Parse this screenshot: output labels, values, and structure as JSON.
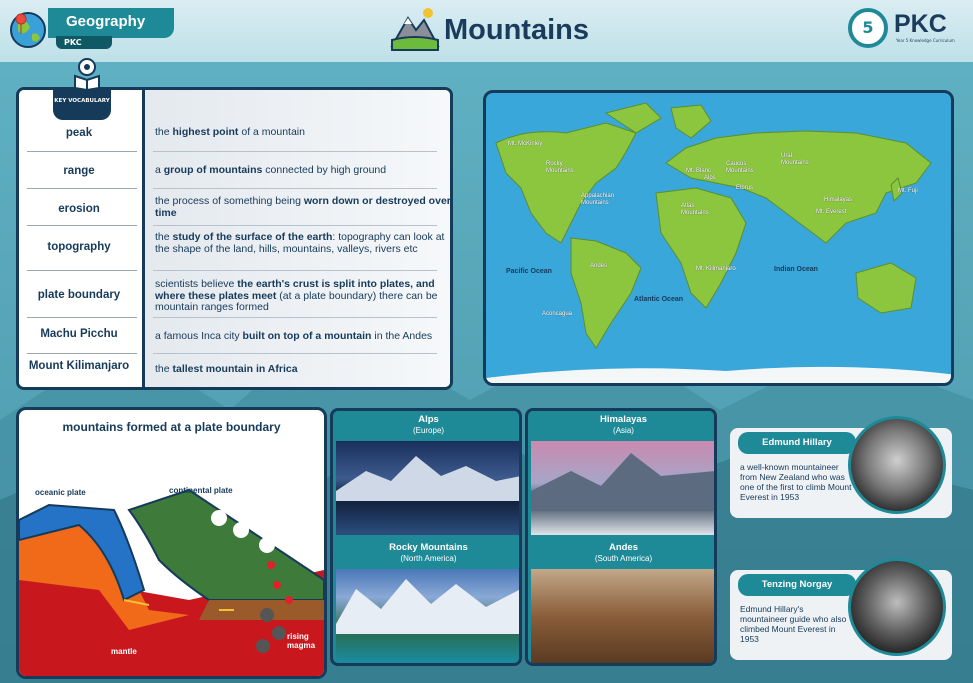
{
  "header": {
    "subject": "Geography",
    "subject_tag": "PKC",
    "title": "Mountains",
    "logo_number": "5",
    "logo_text": "PKC",
    "logo_subtext": "Year 5 Knowledge Curriculum"
  },
  "vocabulary": {
    "badge": "KEY VOCABULARY",
    "rows": [
      {
        "term": "peak",
        "def_html": "the <b>highest point</b> of a mountain"
      },
      {
        "term": "range",
        "def_html": "a <b>group of mountains</b> connected by high ground"
      },
      {
        "term": "erosion",
        "def_html": "the process of something being <b>worn down or destroyed over time</b>"
      },
      {
        "term": "topography",
        "def_html": "the <b>study of the surface of the earth</b>: topography can look at the shape of the land, hills, mountains, valleys, rivers etc"
      },
      {
        "term": "plate boundary",
        "def_html": "scientists believe <b>the earth's crust is split into plates, and where these plates meet</b> (at a plate boundary) there can be mountain ranges formed"
      },
      {
        "term": "Machu Picchu",
        "def_html": "a famous Inca city <b>built on top of a mountain</b> in the Andes"
      },
      {
        "term": "Mount Kilimanjaro",
        "def_html": "the <b>tallest mountain in Africa</b>"
      }
    ]
  },
  "map": {
    "mountains": [
      "Mt. McKinley",
      "Rocky Mountains",
      "Appalachian Mountains",
      "Andes",
      "Aconcagua",
      "Mt. Blanc",
      "Alps",
      "Caucus Mountains",
      "Elbrus",
      "Ural Mountains",
      "Atlas Mountains",
      "Mt. Kilimanjaro",
      "Himalayas",
      "Mt. Everest",
      "Mt. Fuji"
    ],
    "oceans": [
      "Pacific Ocean",
      "Atlantic Ocean",
      "Indian Ocean"
    ]
  },
  "plate_diagram": {
    "title": "mountains formed at a plate boundary",
    "labels": {
      "oceanic": "oceanic plate",
      "continental": "continental plate",
      "mantle": "mantle",
      "magma": "rising magma"
    }
  },
  "ranges": [
    {
      "name": "Alps",
      "region": "(Europe)"
    },
    {
      "name": "Himalayas",
      "region": "(Asia)"
    },
    {
      "name": "Rocky Mountains",
      "region": "(North America)"
    },
    {
      "name": "Andes",
      "region": "(South America)"
    }
  ],
  "people": [
    {
      "name": "Edmund Hillary",
      "desc": "a well-known mountaineer from New Zealand who was one of the first to climb Mount Everest in 1953"
    },
    {
      "name": "Tenzing Norgay",
      "desc": "Edmund Hillary's mountaineer guide who also climbed Mount Everest in 1953"
    }
  ],
  "colors": {
    "navy": "#163a5a",
    "teal": "#1e8a97",
    "ocean": "#39a7d9",
    "land": "#8cc63f"
  }
}
